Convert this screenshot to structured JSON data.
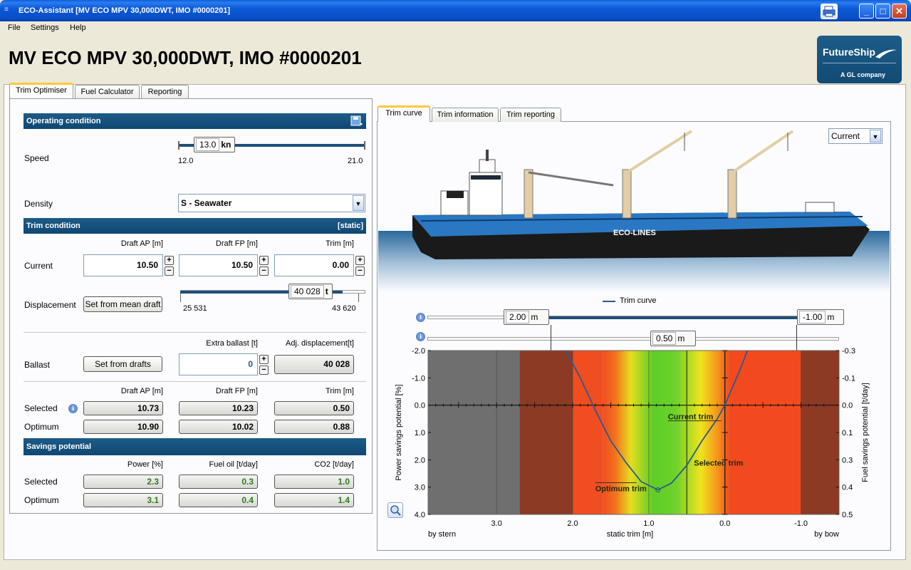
{
  "window": {
    "title": "ECO-Assistant [MV ECO MPV 30,000DWT, IMO #0000201]"
  },
  "menu": [
    "File",
    "Settings",
    "Help"
  ],
  "page_title": "MV ECO MPV 30,000DWT, IMO #0000201",
  "logo": {
    "line1": "FutureShip",
    "line2": "A GL company"
  },
  "main_tabs": [
    "Trim Optimiser",
    "Fuel Calculator",
    "Reporting"
  ],
  "operating": {
    "header": "Operating condition",
    "speed_label": "Speed",
    "speed_value": "13.0",
    "speed_unit": "kn",
    "speed_min": "12.0",
    "speed_max": "21.0",
    "density_label": "Density",
    "density_value": "S - Seawater"
  },
  "trim": {
    "header": "Trim condition",
    "header_right": "[static]",
    "col_ap": "Draft AP [m]",
    "col_fp": "Draft FP [m]",
    "col_trim": "Trim [m]",
    "current_label": "Current",
    "current_ap": "10.50",
    "current_fp": "10.50",
    "current_trim": "0.00",
    "displacement_label": "Displacement",
    "set_mean_btn": "Set from mean draft",
    "disp_value": "40 028",
    "disp_unit": "t",
    "disp_min": "25 531",
    "disp_max": "43 620",
    "extra_ballast_hdr": "Extra ballast [t]",
    "adj_disp_hdr": "Adj. displacement[t]",
    "ballast_label": "Ballast",
    "set_drafts_btn": "Set from drafts",
    "extra_ballast": "0",
    "adj_disp": "40 028",
    "selected_label": "Selected",
    "selected_ap": "10.73",
    "selected_fp": "10.23",
    "selected_trim": "0.50",
    "optimum_label": "Optimum",
    "optimum_ap": "10.90",
    "optimum_fp": "10.02",
    "optimum_trim": "0.88"
  },
  "savings": {
    "header": "Savings potential",
    "col_power": "Power [%]",
    "col_fuel": "Fuel oil [t/day]",
    "col_co2": "CO2 [t/day]",
    "selected_label": "Selected",
    "selected_power": "2.3",
    "selected_fuel": "0.3",
    "selected_co2": "1.0",
    "optimum_label": "Optimum",
    "optimum_power": "3.1",
    "optimum_fuel": "0.4",
    "optimum_co2": "1.4"
  },
  "right_tabs": [
    "Trim curve",
    "Trim information",
    "Trim reporting"
  ],
  "view_select": "Current",
  "ship_name": "ECO-LINES",
  "sliders": {
    "left_value": "2.00",
    "right_value": "-1.00",
    "center_value": "0.50",
    "unit": "m"
  },
  "colors": {
    "section": "#1d5b86",
    "accent": "#ffc83c",
    "curve": "#2a5b8c"
  },
  "chart_data": {
    "type": "line",
    "series": [
      {
        "name": "Trim curve",
        "x": [
          2.15,
          1.9,
          1.7,
          1.5,
          1.3,
          1.1,
          0.88,
          0.7,
          0.5,
          0.3,
          0.1,
          0.0,
          -0.2,
          -0.35
        ],
        "y": [
          -2.3,
          -1.0,
          0.2,
          1.3,
          2.1,
          2.8,
          3.1,
          2.85,
          2.2,
          1.3,
          0.5,
          0.0,
          -1.3,
          -2.4
        ]
      }
    ],
    "xlabel": "static trim [m]",
    "ylabel": "Power savings potential [%]",
    "y2label": "Fuel savings potential [t/day]",
    "x_left_label": "by stern",
    "x_right_label": "by bow",
    "xlim": [
      3.9,
      -1.5
    ],
    "ylim": [
      -2.0,
      4.0
    ],
    "x_ticks": [
      "3.0",
      "2.0",
      "1.0",
      "0.0",
      "-1.0"
    ],
    "x_tick_values": [
      3.0,
      2.0,
      1.0,
      0.0,
      -1.0
    ],
    "y_ticks": [
      "-2.0",
      "-1.0",
      "0.0",
      "1.0",
      "2.0",
      "3.0",
      "4.0"
    ],
    "y2_ticks": [
      "-0.3",
      "-0.1",
      "0.0",
      "0.1",
      "0.3",
      "0.4",
      "0.5"
    ],
    "annotations": [
      {
        "text": "Current trim",
        "x": 0.0,
        "y": 0.0
      },
      {
        "text": "Selected trim",
        "x": 0.5,
        "y": 2.0
      },
      {
        "text": "Optimum trim",
        "x": 0.88,
        "y": 3.1
      }
    ],
    "markers": {
      "current": 0.0,
      "selected": 0.5,
      "optimum": 0.88
    }
  }
}
